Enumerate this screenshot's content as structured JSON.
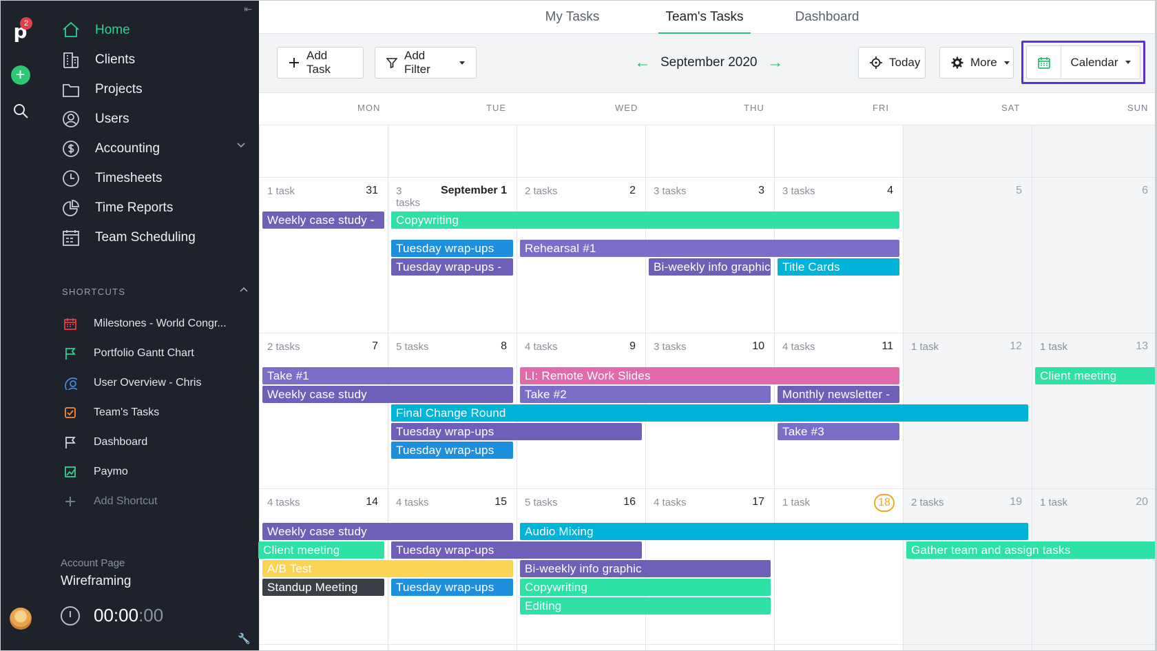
{
  "rail": {
    "logo": "p",
    "notification_count": "2",
    "add_symbol": "+"
  },
  "sidebar": {
    "nav": [
      {
        "label": "Home",
        "icon": "home-icon",
        "active": true
      },
      {
        "label": "Clients",
        "icon": "building-icon"
      },
      {
        "label": "Projects",
        "icon": "folder-icon"
      },
      {
        "label": "Users",
        "icon": "user-circle-icon"
      },
      {
        "label": "Accounting",
        "icon": "dollar-icon",
        "expandable": true
      },
      {
        "label": "Timesheets",
        "icon": "clock-icon"
      },
      {
        "label": "Time Reports",
        "icon": "pie-chart-icon"
      },
      {
        "label": "Team Scheduling",
        "icon": "calendar-grid-icon"
      }
    ],
    "shortcuts_heading": "SHORTCUTS",
    "shortcuts": [
      {
        "label": "Milestones - World Congr...",
        "icon": "calendar-icon",
        "color": "#e5404a"
      },
      {
        "label": "Portfolio Gantt Chart",
        "icon": "flag-icon",
        "color": "#2fd191"
      },
      {
        "label": "User Overview - Chris",
        "icon": "user-circle-icon",
        "color": "#3a8ee6"
      },
      {
        "label": "Team's Tasks",
        "icon": "checkbox-icon",
        "color": "#f28a3c"
      },
      {
        "label": "Dashboard",
        "icon": "flag-icon",
        "color": "#d6d9de"
      },
      {
        "label": "Paymo",
        "icon": "chart-icon",
        "color": "#2fd191"
      },
      {
        "label": "Add Shortcut",
        "icon": "plus-icon",
        "color": "#7f8792"
      }
    ],
    "account_caption": "Account Page",
    "account_name": "Wireframing",
    "timer_main": "00:00",
    "timer_seconds": ":00"
  },
  "tabs": [
    {
      "label": "My Tasks"
    },
    {
      "label": "Team's Tasks",
      "active": true
    },
    {
      "label": "Dashboard"
    }
  ],
  "toolbar": {
    "add_task": "Add Task",
    "add_filter": "Add Filter",
    "month": "September 2020",
    "today": "Today",
    "more": "More",
    "view": "Calendar"
  },
  "weekdays": [
    "MON",
    "TUE",
    "WED",
    "THU",
    "FRI",
    "SAT",
    "SUN"
  ],
  "weeks": [
    {
      "days": [
        {
          "count": "1 task",
          "date": "31"
        },
        {
          "count": "3 tasks",
          "date": "September 1",
          "month_label": true
        },
        {
          "count": "2 tasks",
          "date": "2"
        },
        {
          "count": "3 tasks",
          "date": "3"
        },
        {
          "count": "3 tasks",
          "date": "4"
        },
        {
          "count": "",
          "date": "5",
          "dim": true
        },
        {
          "count": "",
          "date": "6",
          "dim": true
        }
      ]
    },
    {
      "days": [
        {
          "count": "2 tasks",
          "date": "7"
        },
        {
          "count": "5 tasks",
          "date": "8"
        },
        {
          "count": "4 tasks",
          "date": "9"
        },
        {
          "count": "3 tasks",
          "date": "10"
        },
        {
          "count": "4 tasks",
          "date": "11"
        },
        {
          "count": "1 task",
          "date": "12",
          "dim": true
        },
        {
          "count": "1 task",
          "date": "13",
          "dim": true
        }
      ]
    },
    {
      "days": [
        {
          "count": "4 tasks",
          "date": "14"
        },
        {
          "count": "4 tasks",
          "date": "15"
        },
        {
          "count": "5 tasks",
          "date": "16"
        },
        {
          "count": "4 tasks",
          "date": "17"
        },
        {
          "count": "1 task",
          "date": "18",
          "today": true
        },
        {
          "count": "2 tasks",
          "date": "19",
          "dim": true
        },
        {
          "count": "1 task",
          "date": "20",
          "dim": true
        }
      ]
    }
  ],
  "events": [
    {
      "label": "Weekly case study -",
      "color": "purple",
      "week": 0,
      "start": 0,
      "span": 1,
      "row": 0
    },
    {
      "label": "Copywriting",
      "color": "teal",
      "week": 0,
      "start": 1,
      "span": 4,
      "row": 0
    },
    {
      "label": "Rehearsal #1",
      "color": "violet",
      "week": 0,
      "start": 2,
      "span": 3,
      "row": 1,
      "offset": 14
    },
    {
      "label": "Tuesday wrap-ups",
      "color": "blue",
      "week": 0,
      "start": 1,
      "span": 1,
      "row": 1,
      "offset": 14
    },
    {
      "label": "Tuesday wrap-ups -",
      "color": "purple",
      "week": 0,
      "start": 1,
      "span": 1,
      "row": 2,
      "offset": 14
    },
    {
      "label": "Bi-weekly info graphic",
      "color": "purple",
      "week": 0,
      "start": 3,
      "span": 1,
      "row": 2,
      "offset": 14
    },
    {
      "label": "Title Cards",
      "color": "cyan",
      "week": 0,
      "start": 4,
      "span": 1,
      "row": 2,
      "offset": 14
    },
    {
      "label": "Take #1",
      "color": "violet",
      "week": 1,
      "start": 0,
      "span": 2,
      "row": 0
    },
    {
      "label": "LI: Remote Work Slides",
      "color": "pink",
      "week": 1,
      "start": 2,
      "span": 3,
      "row": 0
    },
    {
      "label": "Client meeting",
      "color": "teal",
      "week": 1,
      "start": 6,
      "span": 1,
      "row": 0,
      "open_end": true
    },
    {
      "label": "Weekly case study",
      "color": "purple",
      "week": 1,
      "start": 0,
      "span": 2,
      "row": 1
    },
    {
      "label": "Take #2",
      "color": "violet",
      "week": 1,
      "start": 2,
      "span": 2,
      "row": 1
    },
    {
      "label": "Monthly newsletter -",
      "color": "purple",
      "week": 1,
      "start": 4,
      "span": 1,
      "row": 1
    },
    {
      "label": "Final Change Round",
      "color": "cyan",
      "week": 1,
      "start": 1,
      "span": 5,
      "row": 2,
      "trim": 10
    },
    {
      "label": "Tuesday wrap-ups",
      "color": "purple",
      "week": 1,
      "start": 1,
      "span": 2,
      "row": 3
    },
    {
      "label": "Take #3",
      "color": "violet",
      "week": 1,
      "start": 4,
      "span": 1,
      "row": 3
    },
    {
      "label": "Tuesday wrap-ups",
      "color": "blue",
      "week": 1,
      "start": 1,
      "span": 1,
      "row": 4
    },
    {
      "label": "Weekly case study",
      "color": "purple",
      "week": 2,
      "start": 0,
      "span": 2,
      "row": 0
    },
    {
      "label": "Audio Mixing",
      "color": "cyan",
      "week": 2,
      "start": 2,
      "span": 4,
      "row": 0,
      "trim": 10
    },
    {
      "label": "Client meeting",
      "color": "teal",
      "week": 2,
      "start": 0,
      "span": 1,
      "row": 1,
      "lead": -6
    },
    {
      "label": "Tuesday wrap-ups",
      "color": "purple",
      "week": 2,
      "start": 1,
      "span": 2,
      "row": 1
    },
    {
      "label": "Gather team and assign tasks",
      "color": "teal",
      "week": 2,
      "start": 5,
      "span": 2,
      "row": 1,
      "open_end": true
    },
    {
      "label": "A/B Test",
      "color": "yellow",
      "week": 2,
      "start": 0,
      "span": 2,
      "row": 2
    },
    {
      "label": "Bi-weekly info graphic",
      "color": "purple",
      "week": 2,
      "start": 2,
      "span": 2,
      "row": 2
    },
    {
      "label": "Standup Meeting",
      "color": "dark",
      "week": 2,
      "start": 0,
      "span": 1,
      "row": 3
    },
    {
      "label": "Tuesday wrap-ups",
      "color": "blue",
      "week": 2,
      "start": 1,
      "span": 1,
      "row": 3
    },
    {
      "label": "Copywriting",
      "color": "teal",
      "week": 2,
      "start": 2,
      "span": 2,
      "row": 3
    },
    {
      "label": "Editing",
      "color": "teal",
      "week": 2,
      "start": 2,
      "span": 2,
      "row": 4
    }
  ]
}
